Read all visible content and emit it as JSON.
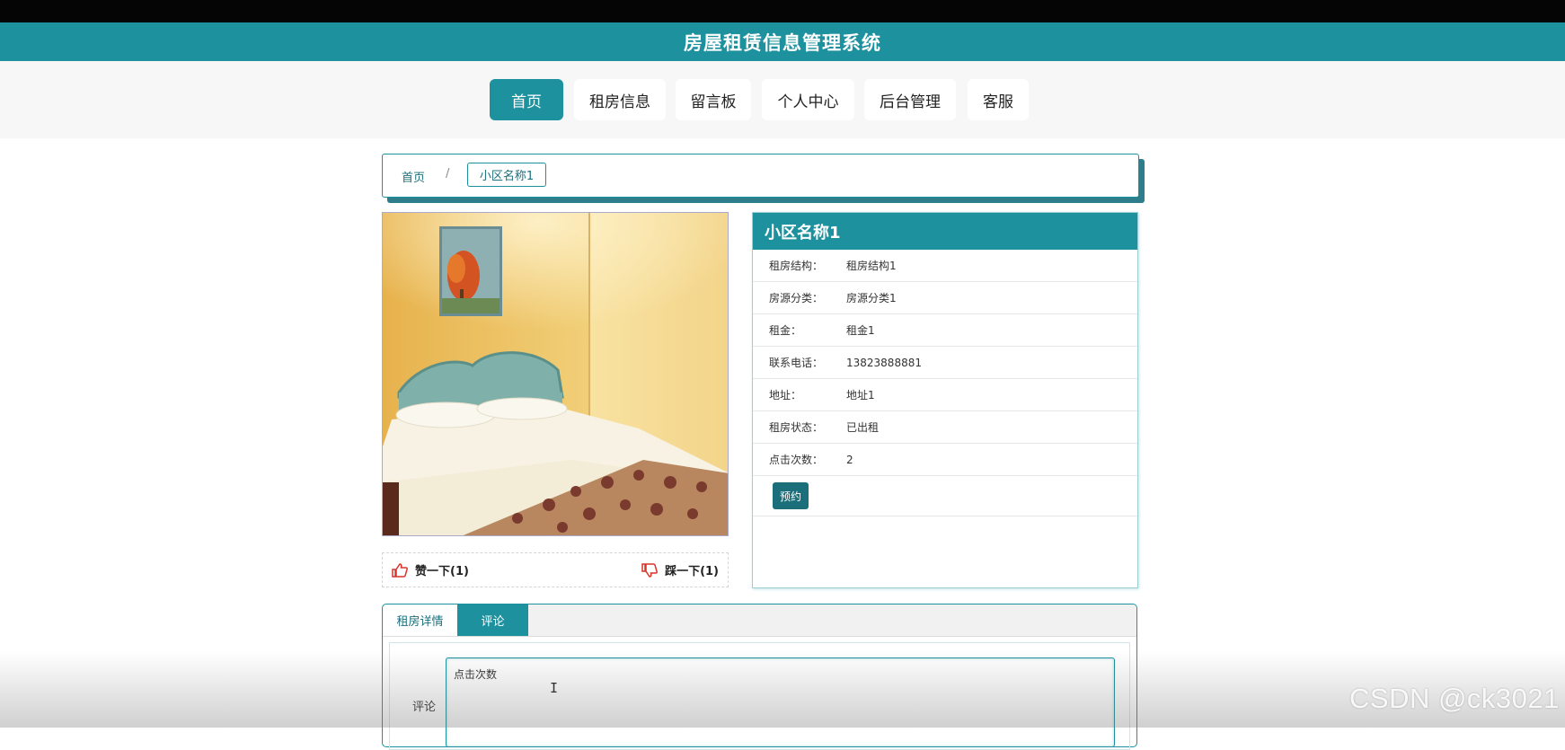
{
  "app": {
    "title": "房屋租赁信息管理系统"
  },
  "nav": {
    "items": [
      {
        "label": "首页",
        "active": true
      },
      {
        "label": "租房信息"
      },
      {
        "label": "留言板"
      },
      {
        "label": "个人中心"
      },
      {
        "label": "后台管理"
      },
      {
        "label": "客服"
      }
    ]
  },
  "breadcrumb": {
    "home": "首页",
    "separator": "/",
    "current": "小区名称1"
  },
  "photo": {
    "alt": "bedroom-photo"
  },
  "votes": {
    "like_label": "赞一下(1)",
    "dislike_label": "踩一下(1)",
    "like_icon": "thumbs-up-icon",
    "dislike_icon": "thumbs-down-icon"
  },
  "detail": {
    "title": "小区名称1",
    "rows": [
      {
        "key": "租房结构：",
        "value": "租房结构1"
      },
      {
        "key": "房源分类：",
        "value": "房源分类1"
      },
      {
        "key": "租金：",
        "value": "租金1"
      },
      {
        "key": "联系电话：",
        "value": "13823888881"
      },
      {
        "key": "地址：",
        "value": "地址1"
      },
      {
        "key": "租房状态：",
        "value": "已出租"
      },
      {
        "key": "点击次数：",
        "value": "2"
      }
    ],
    "book_button": "预约"
  },
  "tabs": {
    "items": [
      {
        "label": "租房详情"
      },
      {
        "label": "评论",
        "active": true
      }
    ],
    "comment_label": "评论",
    "comment_value": "点击次数"
  },
  "watermark": "CSDN @ck3021",
  "colors": {
    "primary": "#1d919e",
    "dark": "#1a6f7b"
  }
}
